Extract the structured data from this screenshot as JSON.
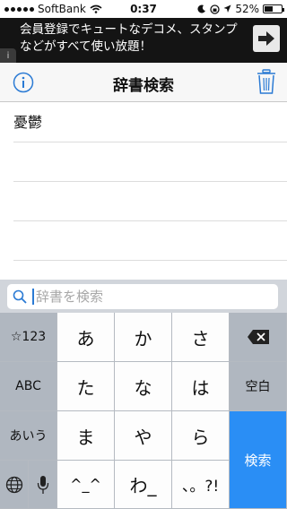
{
  "status_bar": {
    "carrier": "SoftBank",
    "time": "0:37",
    "battery": "52%",
    "battery_level": 0.52
  },
  "ad": {
    "text": "会員登録でキュートなデコメ、スタンプなどがすべて使い放題！",
    "info_label": "i",
    "arrow_icon": "arrow-right-icon"
  },
  "nav": {
    "title": "辞書検索",
    "info_icon": "info-icon",
    "trash_icon": "trash-icon",
    "accent_color": "#2a7ad4"
  },
  "list": {
    "items": [
      "憂鬱",
      "",
      "",
      ""
    ]
  },
  "search": {
    "value": "",
    "placeholder": "辞書を検索"
  },
  "keyboard": {
    "left": [
      "☆123",
      "ABC",
      "あいう"
    ],
    "rows": [
      [
        "あ",
        "か",
        "さ"
      ],
      [
        "た",
        "な",
        "は"
      ],
      [
        "ま",
        "や",
        "ら"
      ],
      [
        "^_^",
        "わ_",
        "、。?!"
      ]
    ],
    "right": {
      "backspace_icon": "backspace-icon",
      "space": "空白",
      "search": "検索"
    },
    "globe_icon": "globe-icon",
    "mic_icon": "mic-icon",
    "return_color": "#2a8ef5"
  }
}
